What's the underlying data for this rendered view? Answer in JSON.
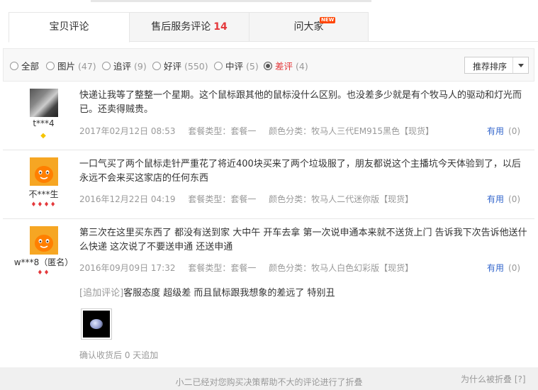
{
  "tabs": [
    {
      "label": "宝贝评论",
      "count": "",
      "active": true
    },
    {
      "label": "售后服务评论",
      "count": "14"
    },
    {
      "label": "问大家",
      "badge": "NEW"
    }
  ],
  "filters": [
    {
      "label": "全部",
      "count": ""
    },
    {
      "label": "图片",
      "count": "(47)"
    },
    {
      "label": "追评",
      "count": "(9)"
    },
    {
      "label": "好评",
      "count": "(550)"
    },
    {
      "label": "中评",
      "count": "(5)"
    },
    {
      "label": "差评",
      "count": "(4)",
      "checked": true
    }
  ],
  "sort": {
    "label": "推荐排序"
  },
  "reviews": [
    {
      "user": "t***4",
      "rank": "◆",
      "content": "快递让我等了整整一个星期。这个鼠标跟其他的鼠标没什么区别。也没差多少就是有个牧马人的驱动和灯光而已。还卖得贼贵。",
      "date": "2017年02月12日 08:53",
      "package": "套餐类型：套餐一",
      "color": "颜色分类：牧马人三代EM915黑色【现货】",
      "helpful": "有用",
      "helpful_count": "(0)"
    },
    {
      "user": "不***生",
      "rank": "♦♦♦♦",
      "content": "一口气买了两个鼠标走针严重花了将近400块买来了两个垃圾服了，朋友都说这个主播坑今天体验到了，以后永远不会来买这家店的任何东西",
      "date": "2016年12月22日 04:19",
      "package": "套餐类型：套餐一",
      "color": "颜色分类：牧马人二代迷你版【现货】",
      "helpful": "有用",
      "helpful_count": "(0)"
    },
    {
      "user": "w***8（匿名）",
      "rank": "♦♦",
      "content": "第三次在这里买东西了 都没有送到家 大中午 开车去拿 第一次说申通本来就不送货上门 告诉我下次告诉他送什么快递 这次说了不要送申通 还送申通",
      "date": "2016年09月09日 17:32",
      "package": "套餐类型：套餐一",
      "color": "颜色分类：牧马人白色幻彩版【现货】",
      "helpful": "有用",
      "helpful_count": "(0)",
      "append_tag": "[追加评论]",
      "append_text": "客服态度 超级差 而且鼠标跟我想象的差远了 特别丑",
      "append_time": "确认收货后 0 天追加"
    }
  ],
  "folded": {
    "message": "小二已经对您购买决策帮助不大的评论进行了折叠",
    "why": "为什么被折叠 [?]"
  }
}
